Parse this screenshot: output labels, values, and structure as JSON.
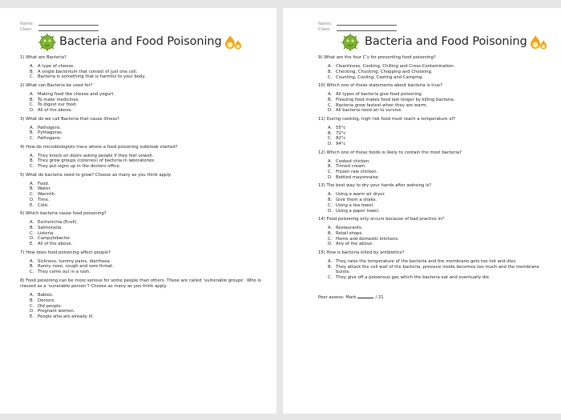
{
  "document": {
    "title": "Bacteria and Food Poisoning",
    "name_label": "Name:",
    "class_label": "Class:",
    "icons": {
      "left": "bacteria-icon",
      "right": "flame-icon"
    }
  },
  "pages": [
    {
      "questions": [
        {
          "text": "1) What are Bacteria?",
          "options": [
            {
              "letter": "A.",
              "text": "A type of cheese."
            },
            {
              "letter": "B.",
              "text": "A single bacterium that consist of just one cell."
            },
            {
              "letter": "C.",
              "text": "Bacteria is something that is harmful to your body."
            }
          ]
        },
        {
          "text": "2) What can Bacteria be used for?",
          "options": [
            {
              "letter": "A.",
              "text": "Making food like cheese and yogurt."
            },
            {
              "letter": "B.",
              "text": "To make medicines."
            },
            {
              "letter": "C.",
              "text": "To digest our food."
            },
            {
              "letter": "D.",
              "text": "All of the above."
            }
          ]
        },
        {
          "text": "3) What do we call Bacteria that cause illness?",
          "options": [
            {
              "letter": "A.",
              "text": "Pathogens."
            },
            {
              "letter": "B.",
              "text": "Pythagoras."
            },
            {
              "letter": "C.",
              "text": "Pathogans."
            }
          ]
        },
        {
          "text": "4) How do microbiologists trace where a food poisoning outbreak started?",
          "options": [
            {
              "letter": "A.",
              "text": "They knock on doors asking people if they feel unwell."
            },
            {
              "letter": "B.",
              "text": "They grow groups (colonies) of bacteria in laboratories."
            },
            {
              "letter": "C.",
              "text": "They put signs up in the doctors office."
            }
          ]
        },
        {
          "text": "5) What do bacteria need to grow? Choose as many as you think apply.",
          "options": [
            {
              "letter": "A.",
              "text": "Food."
            },
            {
              "letter": "B.",
              "text": "Water."
            },
            {
              "letter": "C.",
              "text": "Warmth."
            },
            {
              "letter": "D.",
              "text": "Time."
            },
            {
              "letter": "E.",
              "text": "Cold."
            }
          ]
        },
        {
          "text": "6) Which bacteria cause food poisoning?",
          "options": [
            {
              "letter": "A.",
              "text": "Escherichia (Ecoli)."
            },
            {
              "letter": "B.",
              "text": "Salmonella."
            },
            {
              "letter": "C.",
              "text": "Listeria."
            },
            {
              "letter": "D.",
              "text": "Campylobacter."
            },
            {
              "letter": "E.",
              "text": "All of the above."
            }
          ]
        },
        {
          "text": "7) How does food poisoning affect people?",
          "options": [
            {
              "letter": "A.",
              "text": "Sickness, tummy pains, diarrhoea."
            },
            {
              "letter": "B.",
              "text": "Runny nose, cough and sore throat."
            },
            {
              "letter": "C.",
              "text": "They come out in a rash."
            }
          ]
        },
        {
          "text": "8) Food poisoning can be more serious for some people than others. These are called ‘vulnerable groups’. Who is classed as a ‘vunerable person’? Choose as many as you think apply.",
          "options": [
            {
              "letter": "A.",
              "text": "Babies."
            },
            {
              "letter": "B.",
              "text": "Doctors."
            },
            {
              "letter": "C.",
              "text": "Old people."
            },
            {
              "letter": "D.",
              "text": "Pregnant women."
            },
            {
              "letter": "E.",
              "text": "People who are already ill."
            }
          ]
        }
      ]
    },
    {
      "questions": [
        {
          "text": "9) What are the four C’s for preventing food poisoning?",
          "options": [
            {
              "letter": "A.",
              "text": "Cleanliness, Cooking, Chilling and Cross-Contamination."
            },
            {
              "letter": "B.",
              "text": "Checking, Chucking, Chopping and Choosing."
            },
            {
              "letter": "C.",
              "text": "Counting, Cooling, Casting and Camping."
            }
          ]
        },
        {
          "text": "10) Which one of these statements about bacteria is true?",
          "options": [
            {
              "letter": "A.",
              "text": "All types of bacteria give food poisoning."
            },
            {
              "letter": "B.",
              "text": "Freezing food makes food last longer by killing bacteria."
            },
            {
              "letter": "C.",
              "text": "Bacteria grow fastest when they are warm."
            },
            {
              "letter": "D.",
              "text": "All bacteria need air to survive."
            }
          ]
        },
        {
          "text": "11) During cooking, high risk food must reach a temperature of?",
          "options": [
            {
              "letter": "A.",
              "text": "55°c"
            },
            {
              "letter": "B.",
              "text": "72°c"
            },
            {
              "letter": "C.",
              "text": "82°c"
            },
            {
              "letter": "D.",
              "text": "94°c"
            }
          ]
        },
        {
          "text": "12) Which one of these foods is likely to contain the most bacteria?",
          "options": [
            {
              "letter": "A.",
              "text": "Cooked chicken."
            },
            {
              "letter": "B.",
              "text": "Tinned cream."
            },
            {
              "letter": "C.",
              "text": "Frozen raw chicken."
            },
            {
              "letter": "D.",
              "text": "Bottled mayonnaise."
            }
          ]
        },
        {
          "text": "13) The best way to dry your hands after wahsing is?",
          "options": [
            {
              "letter": "A.",
              "text": "Using a warm air dryer."
            },
            {
              "letter": "B.",
              "text": "Give them a shake."
            },
            {
              "letter": "C.",
              "text": "Using a tea towel."
            },
            {
              "letter": "D.",
              "text": "Using a paper towel."
            }
          ]
        },
        {
          "text": "14) Food poisoning only occurs because of bad practice in?",
          "options": [
            {
              "letter": "A.",
              "text": "Restaurants."
            },
            {
              "letter": "B.",
              "text": "Retail shops."
            },
            {
              "letter": "C.",
              "text": "Home and domestic kitchens."
            },
            {
              "letter": "D.",
              "text": "Any of the above."
            }
          ]
        },
        {
          "text": "15) How is bacteria killed by antibiotics?",
          "options": [
            {
              "letter": "A.",
              "text": "They raise the temperature of the bacteria and the membrane gets too hot and dies."
            },
            {
              "letter": "B.",
              "text": "They attack the cell wall of the bacteria, pressure inside becomes too much and the membrane bursts."
            },
            {
              "letter": "C.",
              "text": "They give off a poisonous gas which the bacteria eat and eventually die."
            }
          ]
        }
      ],
      "footer": {
        "label": "Peer assess: Mark",
        "total": "/ 21"
      }
    }
  ]
}
